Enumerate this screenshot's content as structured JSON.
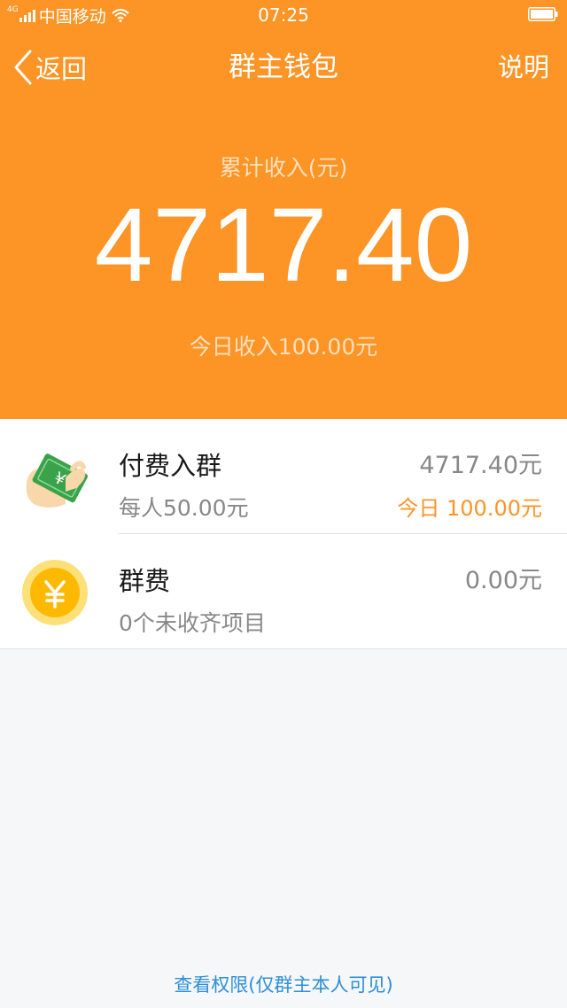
{
  "status_bar": {
    "network_type": "4G",
    "carrier": "中国移动",
    "time": "07:25",
    "icons": [
      "signal-icon",
      "wifi-icon",
      "battery-icon"
    ]
  },
  "nav": {
    "back_label": "返回",
    "title": "群主钱包",
    "help_label": "说明"
  },
  "summary": {
    "income_label": "累计收入(元)",
    "income_amount": "4717.40",
    "today_income": "今日收入100.00元"
  },
  "items": [
    {
      "icon": "cash-hand-icon",
      "title": "付费入群",
      "subtitle": "每人50.00元",
      "amount": "4717.40元",
      "today": "今日 100.00元"
    },
    {
      "icon": "yuan-coin-icon",
      "title": "群费",
      "subtitle": "0个未收齐项目",
      "amount": "0.00元"
    }
  ],
  "footer": {
    "link_label": "查看权限(仅群主本人可见)"
  },
  "colors": {
    "header_bg": "#fd9426",
    "accent_orange": "#fd9426",
    "link_blue": "#2d8fd8",
    "page_bg": "#f6f7f9"
  }
}
